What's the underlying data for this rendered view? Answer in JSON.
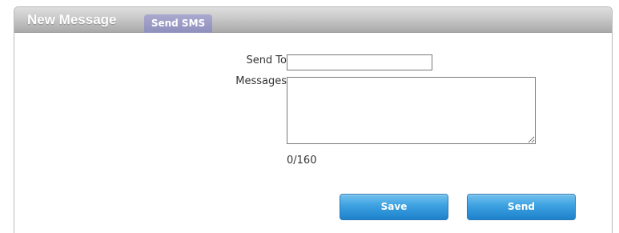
{
  "header": {
    "title": "New Message",
    "tab_label": "Send SMS"
  },
  "form": {
    "send_to_label": "Send To",
    "send_to_value": "",
    "messages_label": "Messages",
    "messages_value": "",
    "char_counter": "0/160"
  },
  "actions": {
    "save_label": "Save",
    "send_label": "Send"
  },
  "colors": {
    "tab": "#8f8fbd",
    "button": "#3ca0e0",
    "header": "#c9c9c9"
  }
}
